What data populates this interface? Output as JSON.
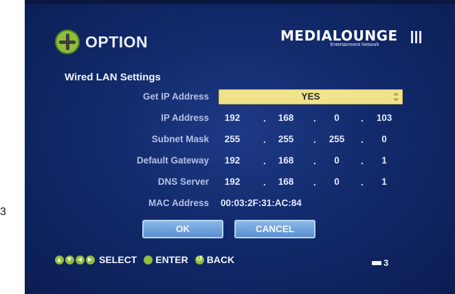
{
  "title": "OPTION",
  "logo": {
    "name": "MEDIALOUNGE",
    "tagline": "Entertainment Network"
  },
  "section_title": "Wired LAN Settings",
  "get_ip": {
    "label": "Get IP Address",
    "value": "YES"
  },
  "ip": {
    "label": "IP Address",
    "octets": [
      "192",
      "168",
      "0",
      "103"
    ]
  },
  "subnet": {
    "label": "Subnet Mask",
    "octets": [
      "255",
      "255",
      "255",
      "0"
    ]
  },
  "gateway": {
    "label": "Default Gateway",
    "octets": [
      "192",
      "168",
      "0",
      "1"
    ]
  },
  "dns": {
    "label": "DNS Server",
    "octets": [
      "192",
      "168",
      "0",
      "1"
    ]
  },
  "mac": {
    "label": "MAC Address",
    "value": "00:03:2F:31:AC:84"
  },
  "buttons": {
    "ok": "OK",
    "cancel": "CANCEL"
  },
  "footer": {
    "select": "SELECT",
    "enter": "ENTER",
    "back": "BACK",
    "page": "3"
  },
  "stray": "3",
  "colors": {
    "background": "#122a6b",
    "highlight": "#f0e38b",
    "button": "#6a9fd9",
    "accent_green": "#8fbe3b"
  }
}
